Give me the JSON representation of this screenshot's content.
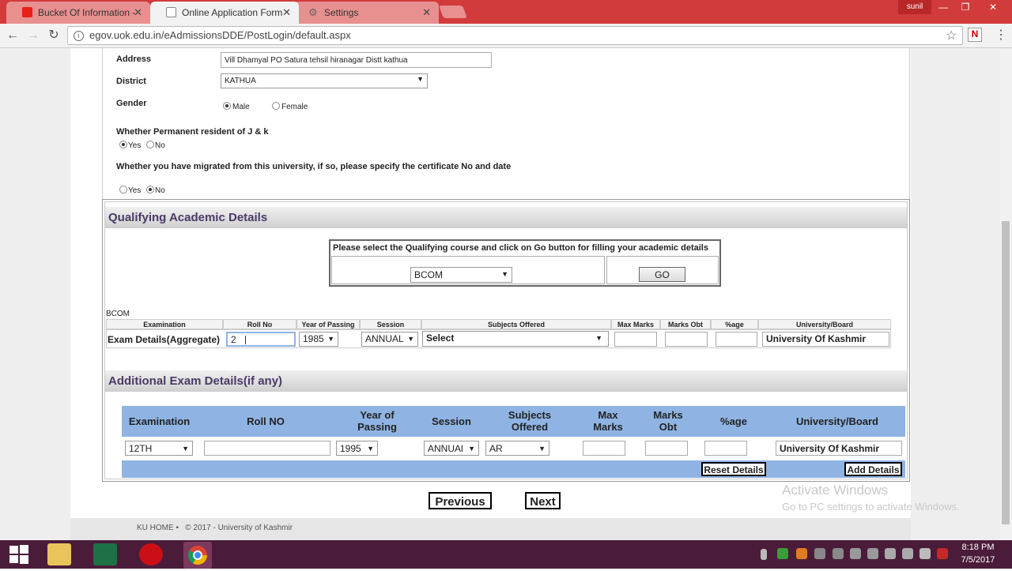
{
  "browser": {
    "tabs": [
      {
        "title": "Bucket Of Information - ",
        "icon": "youtube-icon"
      },
      {
        "title": "Online Application Form",
        "icon": "page-icon"
      },
      {
        "title": "Settings",
        "icon": "gear-icon"
      }
    ],
    "user": "sunil",
    "url": "egov.uok.edu.in/eAdmissionsDDE/PostLogin/default.aspx",
    "extension_letter": "N"
  },
  "form": {
    "address_label": "Address",
    "address_value": "Vill Dhamyal PO Satura tehsil hiranagar Distt kathua",
    "district_label": "District",
    "district_value": "KATHUA",
    "gender_label": "Gender",
    "gender_male": "Male",
    "gender_female": "Female",
    "permanent_label": "Whether Permanent resident of J & k",
    "migrated_label": "Whether you have migrated from this university, if so, please specify the certificate No and date",
    "yes": "Yes",
    "no": "No"
  },
  "qualifying": {
    "heading": "Qualifying Academic Details",
    "instruction": "Please select the Qualifying course and click on Go button for filling your academic details",
    "course_value": "BCOM",
    "go_label": "GO",
    "course_caption": "BCOM",
    "columns": [
      "Examination",
      "Roll No",
      "Year of Passing",
      "Session",
      "Subjects Offered",
      "Max Marks",
      "Marks Obt",
      "%age",
      "University/Board"
    ],
    "row": {
      "examination": "Exam Details(Aggregate)",
      "roll_no": "2",
      "year": "1985",
      "session": "ANNUAL",
      "subjects": "Select",
      "university": "University Of Kashmir"
    }
  },
  "additional": {
    "heading": "Additional Exam Details(if any)",
    "columns": [
      "Examination",
      "Roll NO",
      "Year of Passing",
      "Session",
      "Subjects Offered",
      "Max Marks",
      "Marks Obt",
      "%age",
      "University/Board"
    ],
    "row": {
      "examination": "12TH",
      "year": "1995",
      "session": "ANNUAl",
      "subjects": "AR",
      "university": "University Of Kashmir"
    },
    "reset_label": "Reset Details",
    "add_label": "Add Details"
  },
  "nav": {
    "previous": "Previous",
    "next": "Next"
  },
  "footer": "KU HOME •   © 2017 - University of Kashmir",
  "watermark": {
    "title": "Activate Windows",
    "subtitle": "Go to PC settings to activate Windows."
  },
  "taskbar": {
    "time": "8:18 PM",
    "date": "7/5/2017"
  },
  "colors": {
    "tabbar": "#d13b3b",
    "table_header": "#8fb4e3",
    "section_heading": "#4b3a66",
    "taskbar": "#4b1c3a"
  }
}
